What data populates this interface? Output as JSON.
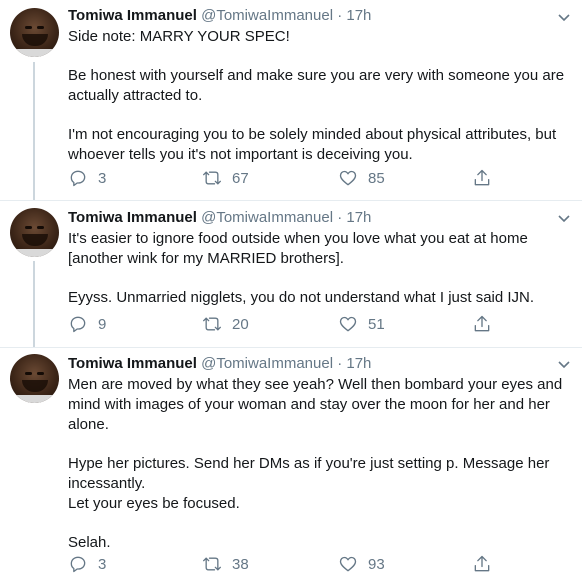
{
  "tweets": [
    {
      "name": "Tomiwa Immanuel",
      "handle": "@TomiwaImmanuel",
      "dot": "·",
      "time": "17h",
      "paragraphs": [
        "Side note: MARRY YOUR SPEC!",
        "",
        "Be honest with yourself and make sure you are very with someone you are actually attracted to.",
        "",
        "I'm not encouraging you to be solely minded about physical attributes, but whoever tells you it's not important is deceiving you."
      ],
      "replies": "3",
      "retweets": "67",
      "likes": "85"
    },
    {
      "name": "Tomiwa Immanuel",
      "handle": "@TomiwaImmanuel",
      "dot": "·",
      "time": "17h",
      "paragraphs": [
        "It's easier to ignore food outside when you love what you eat at home [another wink for my MARRIED brothers].",
        "",
        "Eyyss. Unmarried nigglets, you do not understand what I just said IJN."
      ],
      "replies": "9",
      "retweets": "20",
      "likes": "51"
    },
    {
      "name": "Tomiwa Immanuel",
      "handle": "@TomiwaImmanuel",
      "dot": "·",
      "time": "17h",
      "paragraphs": [
        "Men are moved by what they see yeah? Well then bombard your eyes and mind with images of your woman and stay over the moon for her and her alone.",
        "",
        "Hype her pictures. Send her DMs as if you're just setting p. Message her incessantly.",
        "Let your eyes be focused.",
        "",
        "Selah."
      ],
      "replies": "3",
      "retweets": "38",
      "likes": "93"
    }
  ],
  "icons": {
    "reply": "reply-icon",
    "retweet": "retweet-icon",
    "like": "heart-icon",
    "share": "share-icon",
    "more": "chevron-down-icon"
  },
  "colors": {
    "text": "#14171a",
    "muted": "#657786",
    "thread_line": "#ccd6dd",
    "divider": "#e6ecf0"
  }
}
